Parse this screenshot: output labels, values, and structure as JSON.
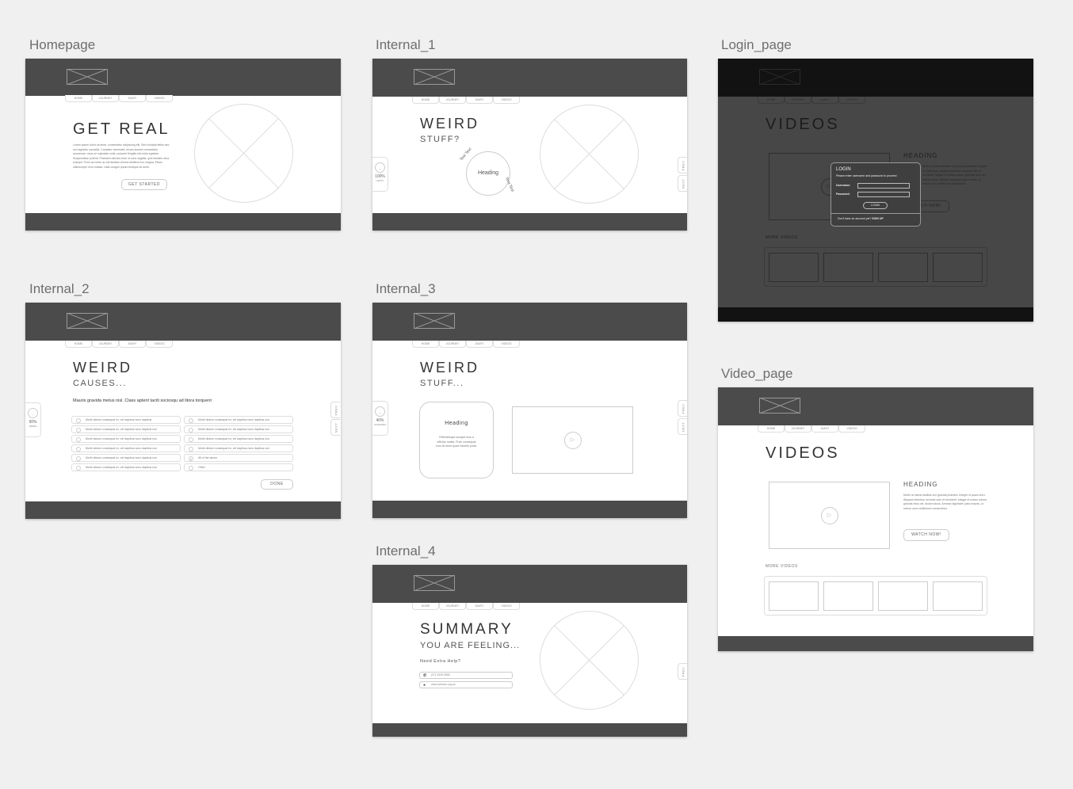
{
  "canvas": {
    "background": "#f0f0f0",
    "header_color": "#4b4b4b"
  },
  "nav": [
    "HOME",
    "JOURNEY",
    "DIARY",
    "VIDEOS"
  ],
  "homepage": {
    "label": "Homepage",
    "title": "GET REAL",
    "body": "Lorem ipsum dolor sit amet, consectetur adipiscing elit. Sed volutpat tellus sed orci egestas convallis. Curabitur venenatis, lectus laoreet consectetur accumsan, risus mi vulputate nulla, posuere fringilla nisi nulla egestas. Suspendisse potenti. Praesent ultrices enim id nunc sagittis, quis facilisis risus suscipit. Proin ac lorem ac est facilisis viverra eleifend non magna. Etiam ullamcorper eros massa, vitae congue ipsum tristique sit amet.",
    "button": "GET STARTED"
  },
  "internal_1": {
    "label": "Internal_1",
    "title": "WEIRD",
    "subtitle": "STUFF?",
    "mood_pct": "100%",
    "mood_label": "HAPPY",
    "heading": "Heading",
    "curve_text_1": "Text Text",
    "curve_text_2": "Text Text",
    "prev": "PREV",
    "next": "NEXT"
  },
  "internal_2": {
    "label": "Internal_2",
    "title": "WEIRD",
    "subtitle": "CAUSES...",
    "mood_pct": "90%",
    "mood_label": "WEIRD",
    "question": "Mauris gravida metus nisl. Class aptent taciti sociosqu ad litora torquent",
    "options_left": [
      "Morbi dictum consequat ex, vel dapibus nunc dapibus",
      "Morbi dictum consequat ex, vel dapibus nunc dapibus non",
      "Morbi dictum consequat ex, vel dapibus nunc dapibus non",
      "Morbi dictum consequat ex, vel dapibus nunc dapibus non",
      "Morbi dictum consequat ex, vel dapibus nunc dapibus non",
      "Morbi dictum consequat ex, vel dapibus nunc dapibus non"
    ],
    "options_right": [
      "Morbi dictum consequat ex, vel dapibus nunc dapibus non",
      "Morbi dictum consequat ex, vel dapibus nunc dapibus non",
      "Morbi dictum consequat ex, vel dapibus nunc dapibus non",
      "Morbi dictum consequat ex, vel dapibus nunc dapibus non",
      "All of the above",
      "Other"
    ],
    "checked_right": "All of the above",
    "done": "DONE",
    "prev": "PREV",
    "next": "NEXT"
  },
  "internal_3": {
    "label": "Internal_3",
    "title": "WEIRD",
    "subtitle": "STUFF...",
    "mood_pct": "40%",
    "mood_label": "WORRIED",
    "card_heading": "Heading",
    "card_body": "Pellentesque suscipit eros a efficitur mattis. Proin consequat eros sit amet quam lobortis porta.",
    "prev": "PREV",
    "next": "NEXT"
  },
  "internal_4": {
    "label": "Internal_4",
    "title": "SUMMARY",
    "subtitle": "YOU ARE FEELING...",
    "help": "Need Extra Help?",
    "phone": "(07) 3325 5559",
    "website": "www.ontrack.org.au",
    "prev": "PREV"
  },
  "login_page": {
    "label": "Login_page",
    "title": "VIDEOS",
    "heading": "HEADING",
    "body": "Morbi ut metus facilisis orci gravida pharetra. Integer id quam arcu. Aliquam interdum sit amet odio et hendrerit. Integer et metus rutrum, gravida risus vel, dictum lacus. Aenean dignissim justo mauris, ut rutrum urna vestibulum consectetur.",
    "watch": "WATCH NOW!",
    "more": "MORE VIDEOS",
    "modal": {
      "title": "LOGIN",
      "instructions": "Please enter username and password to proceed",
      "username_label": "Username:",
      "password_label": "Password:",
      "button": "LOGIN",
      "signup_prompt": "Don't have an account yet?",
      "signup": "SIGN UP"
    }
  },
  "video_page": {
    "label": "Video_page",
    "title": "VIDEOS",
    "heading": "HEADING",
    "body": "Morbi ut metus facilisis orci gravida pharetra. Integer id quam arcu. Aliquam interdum sit amet odio et hendrerit. Integer et metus rutrum, gravida risus vel, dictum lacus. Aenean dignissim justo mauris, ut rutrum urna vestibulum consectetur.",
    "watch": "WATCH NOW!",
    "more": "MORE VIDEOS"
  }
}
